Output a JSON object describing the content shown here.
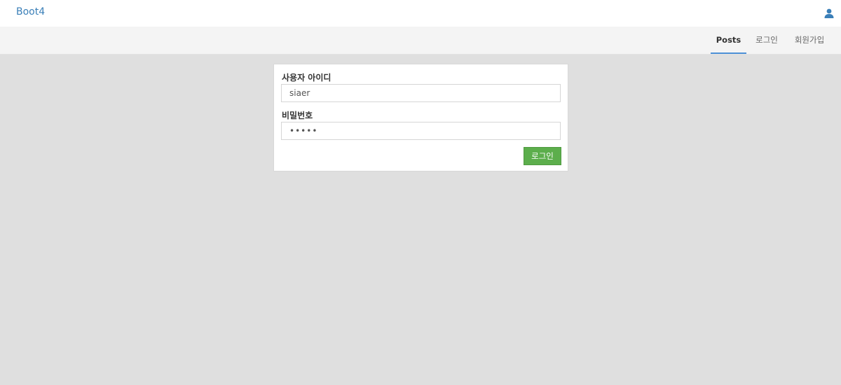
{
  "header": {
    "brand": "Boot4",
    "user_icon": "user-icon"
  },
  "nav": {
    "items": [
      {
        "label": "Posts",
        "active": true
      },
      {
        "label": "로그인",
        "active": false
      },
      {
        "label": "회원가입",
        "active": false
      }
    ]
  },
  "login_form": {
    "username_label": "사용자 아이디",
    "username_value": "siaer",
    "password_label": "비밀번호",
    "password_value": "•••••",
    "submit_label": "로그인"
  },
  "colors": {
    "brand": "#3a7fb8",
    "active_tab_underline": "#4d90d6",
    "login_button": "#5cae4c",
    "page_background": "#dfdfdf"
  }
}
